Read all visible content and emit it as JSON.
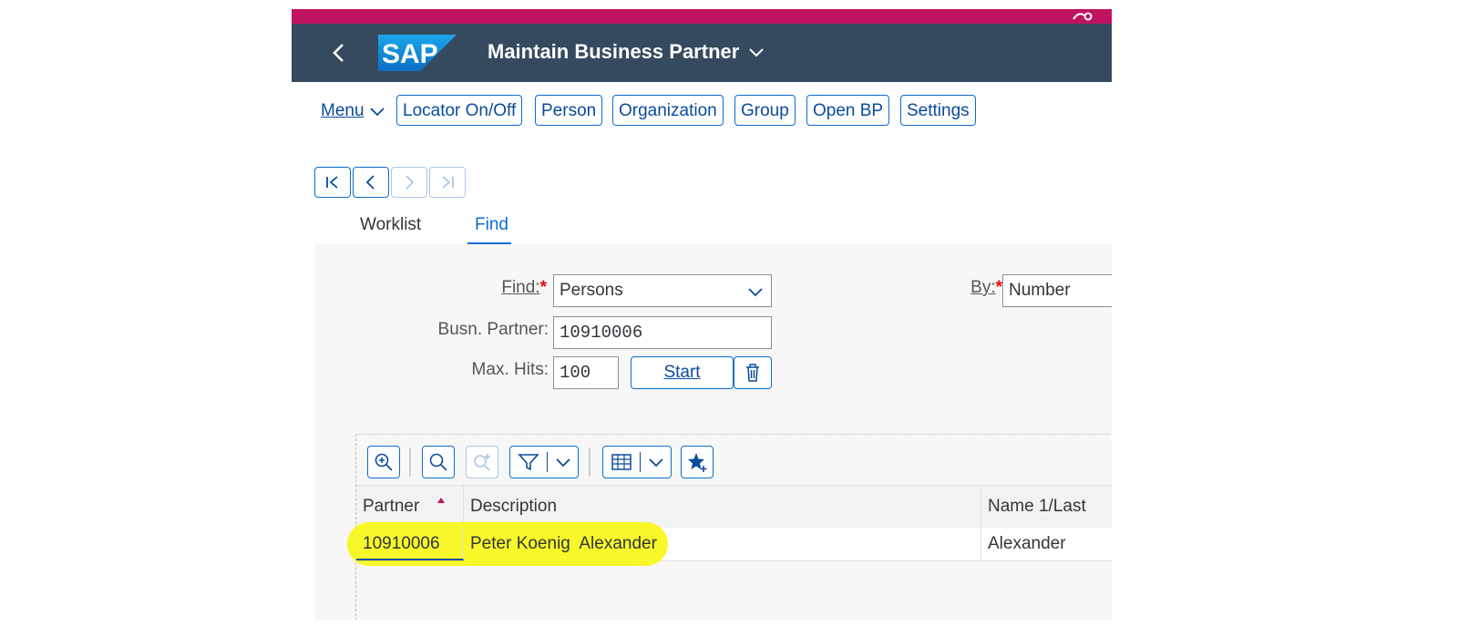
{
  "shell": {
    "title": "Maintain Business Partner",
    "logo_text": "SAP"
  },
  "toolbar": {
    "menu_label": "Menu",
    "buttons": [
      "Locator On/Off",
      "Person",
      "Organization",
      "Group",
      "Open BP",
      "Settings"
    ]
  },
  "tabs": [
    {
      "label": "Worklist",
      "selected": false
    },
    {
      "label": "Find",
      "selected": true
    }
  ],
  "form": {
    "find_label": "Find:",
    "find_value": "Persons",
    "by_label": "By:",
    "by_value": "Number",
    "partner_label": "Busn. Partner:",
    "partner_value": "10910006",
    "maxhits_label": "Max. Hits:",
    "maxhits_value": "100",
    "start_label": "Start"
  },
  "results": {
    "columns": [
      "Partner",
      "Description",
      "Name 1/Last"
    ],
    "rows": [
      {
        "partner": "10910006",
        "description": "Peter Koenig  Alexander",
        "name": "Alexander"
      }
    ]
  },
  "colors": {
    "shell_bg": "#354a5f",
    "top_bar": "#c0135f",
    "accent": "#0a6ed1",
    "highlight": "#f7f72a"
  }
}
